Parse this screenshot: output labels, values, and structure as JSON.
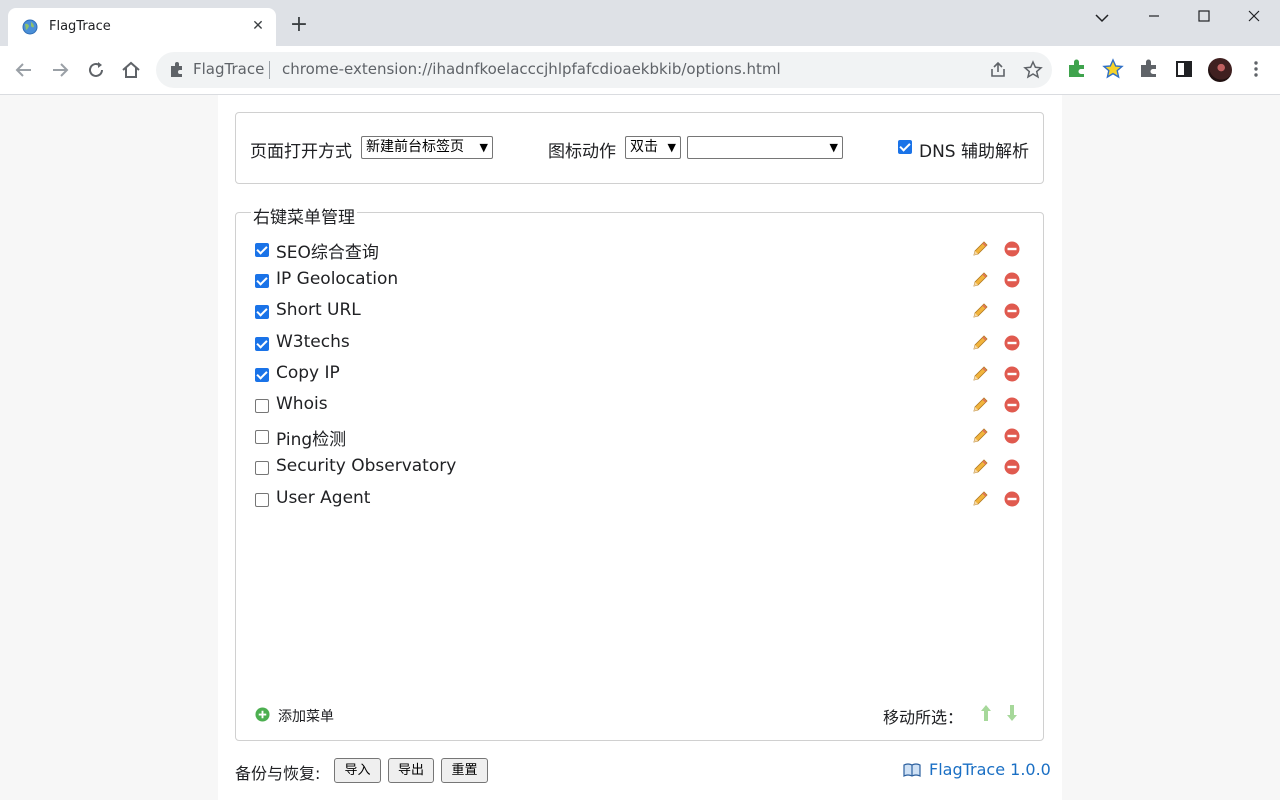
{
  "browser": {
    "tab_title": "FlagTrace",
    "tab_close": "✕",
    "new_tab": "+",
    "omnibox_site": "FlagTrace",
    "omnibox_url": "chrome-extension://ihadnfkoelacccjhlpfafcdioaekbkib/options.html",
    "window_controls": [
      "⌄",
      "—",
      "☐",
      "✕"
    ]
  },
  "settings": {
    "open_mode_label": "页面打开方式",
    "open_mode_value": "新建前台标签页",
    "icon_action_label": "图标动作",
    "icon_action_value": "双击",
    "icon_action_target": "",
    "dns_checked": true,
    "dns_label": "DNS 辅助解析"
  },
  "menu": {
    "legend": "右键菜单管理",
    "items": [
      {
        "label": "SEO综合查询",
        "checked": true
      },
      {
        "label": "IP Geolocation",
        "checked": true
      },
      {
        "label": "Short URL",
        "checked": true
      },
      {
        "label": "W3techs",
        "checked": true
      },
      {
        "label": "Copy IP",
        "checked": true
      },
      {
        "label": "Whois",
        "checked": false
      },
      {
        "label": "Ping检测",
        "checked": false
      },
      {
        "label": "Security Observatory",
        "checked": false
      },
      {
        "label": "User Agent",
        "checked": false
      }
    ],
    "add_label": "添加菜单",
    "move_label": "移动所选："
  },
  "footer": {
    "backup_label": "备份与恢复:",
    "import_label": "导入",
    "export_label": "导出",
    "reset_label": "重置",
    "about": "FlagTrace  1.0.0"
  },
  "colors": {
    "accent": "#1a73e8",
    "link": "#1a6fc4",
    "delete": "#e05a4f",
    "add": "#4caf50"
  }
}
